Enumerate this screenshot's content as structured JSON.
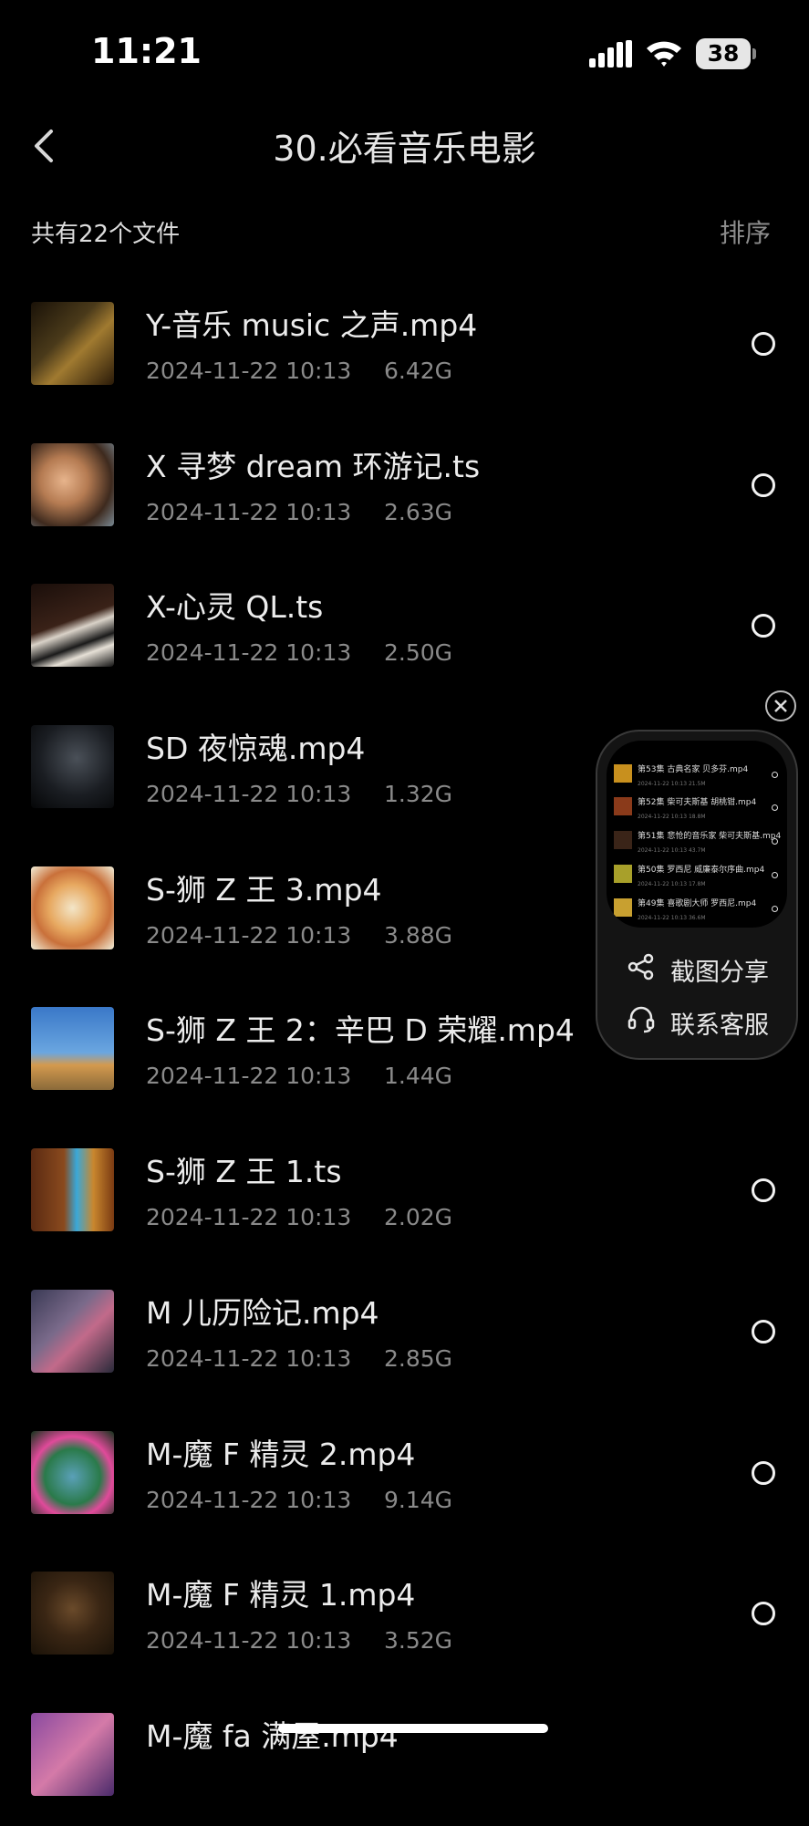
{
  "status": {
    "time": "11:21",
    "battery": "38"
  },
  "nav": {
    "title": "30.必看音乐电影"
  },
  "summary": {
    "count_label": "共有22个文件",
    "sort_label": "排序"
  },
  "files": [
    {
      "name": "Y-音乐 music 之声.mp4",
      "date": "2024-11-22 10:13",
      "size": "6.42G"
    },
    {
      "name": "X 寻梦 dream 环游记.ts",
      "date": "2024-11-22 10:13",
      "size": "2.63G"
    },
    {
      "name": "X-心灵 QL.ts",
      "date": "2024-11-22 10:13",
      "size": "2.50G"
    },
    {
      "name": "SD 夜惊魂.mp4",
      "date": "2024-11-22 10:13",
      "size": "1.32G"
    },
    {
      "name": "S-狮 Z 王 3.mp4",
      "date": "2024-11-22 10:13",
      "size": "3.88G"
    },
    {
      "name": "S-狮 Z 王 2：辛巴 D 荣耀.mp4",
      "date": "2024-11-22 10:13",
      "size": "1.44G"
    },
    {
      "name": "S-狮 Z 王 1.ts",
      "date": "2024-11-22 10:13",
      "size": "2.02G"
    },
    {
      "name": "M 儿历险记.mp4",
      "date": "2024-11-22 10:13",
      "size": "2.85G"
    },
    {
      "name": "M-魔 F 精灵 2.mp4",
      "date": "2024-11-22 10:13",
      "size": "9.14G"
    },
    {
      "name": "M-魔 F 精灵 1.mp4",
      "date": "2024-11-22 10:13",
      "size": "3.52G"
    },
    {
      "name": "M-魔 fa 满屋.mp4",
      "date": "",
      "size": ""
    }
  ],
  "floating_panel": {
    "preview_items": [
      {
        "title": "第53集 古典名家 贝多芬.mp4",
        "meta": "2024-11-22 10:13    21.5M"
      },
      {
        "title": "第52集 柴可夫斯基 胡桃钳.mp4",
        "meta": "2024-11-22 10:13    18.8M"
      },
      {
        "title": "第51集 悲怆的音乐家 柴可夫斯基.mp4",
        "meta": "2024-11-22 10:13    43.7M"
      },
      {
        "title": "第50集 罗西尼 威廉泰尔序曲.mp4",
        "meta": "2024-11-22 10:13    17.8M"
      },
      {
        "title": "第49集 喜歌剧大师 罗西尼.mp4",
        "meta": "2024-11-22 10:13    36.6M"
      }
    ],
    "screenshot_share": "截图分享",
    "contact_service": "联系客服"
  }
}
